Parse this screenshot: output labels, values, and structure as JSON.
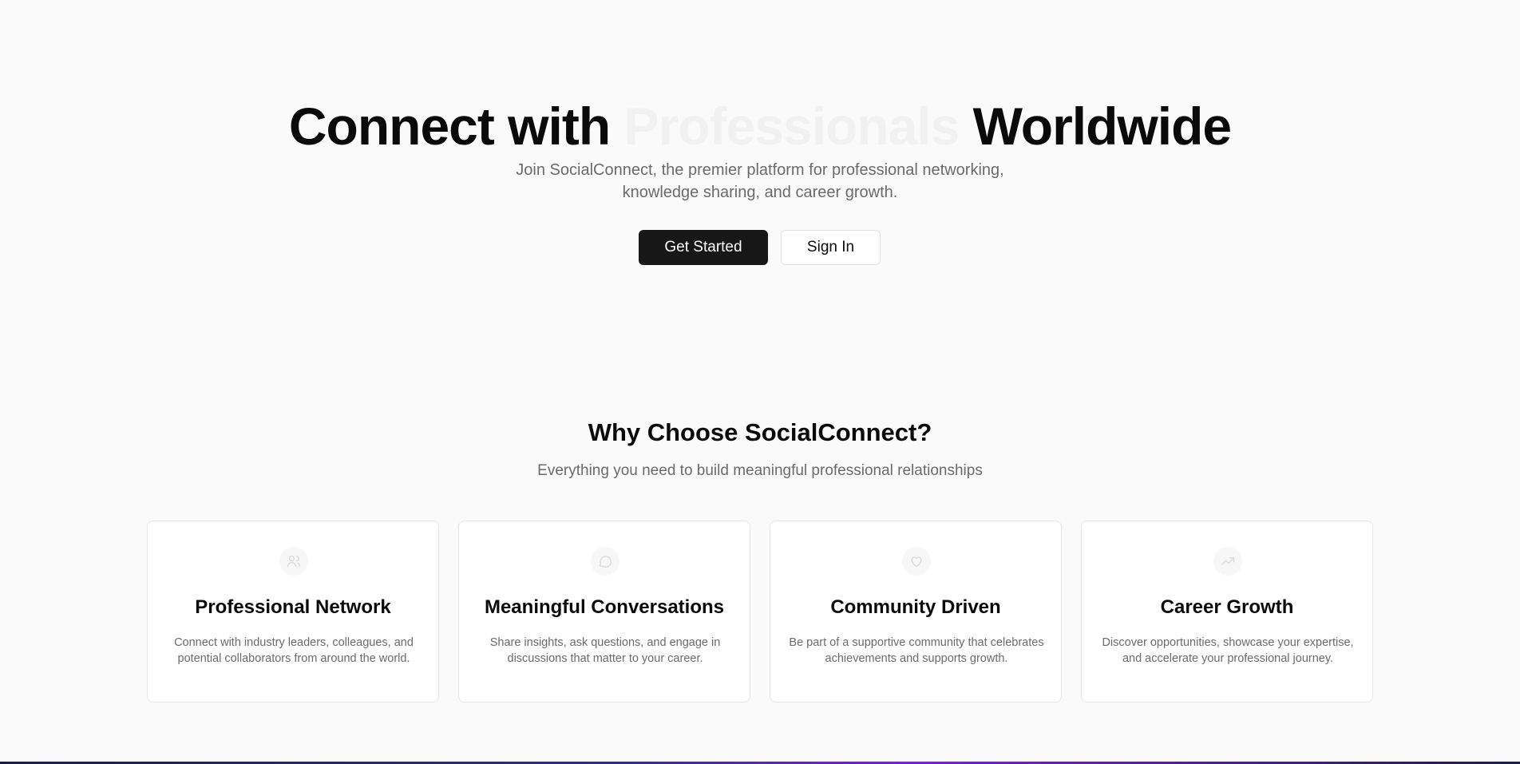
{
  "hero": {
    "title_part1": "Connect with ",
    "title_highlight": "Professionals",
    "title_part2": " Worldwide",
    "subtitle": "Join SocialConnect, the premier platform for professional networking, knowledge sharing, and career growth.",
    "primary_button": "Get Started",
    "secondary_button": "Sign In"
  },
  "features": {
    "title": "Why Choose SocialConnect?",
    "subtitle": "Everything you need to build meaningful professional relationships",
    "cards": [
      {
        "icon": "users-icon",
        "title": "Professional Network",
        "description": "Connect with industry leaders, colleagues, and potential collaborators from around the world."
      },
      {
        "icon": "message-circle-icon",
        "title": "Meaningful Conversations",
        "description": "Share insights, ask questions, and engage in discussions that matter to your career."
      },
      {
        "icon": "heart-icon",
        "title": "Community Driven",
        "description": "Be part of a supportive community that celebrates achievements and supports growth."
      },
      {
        "icon": "trending-up-icon",
        "title": "Career Growth",
        "description": "Discover opportunities, showcase your expertise, and accelerate your professional journey."
      }
    ]
  },
  "colors": {
    "background": "#fafafa",
    "primary": "#171717",
    "muted_text": "#6b6b6b",
    "highlight_text": "#f1f1f1"
  }
}
